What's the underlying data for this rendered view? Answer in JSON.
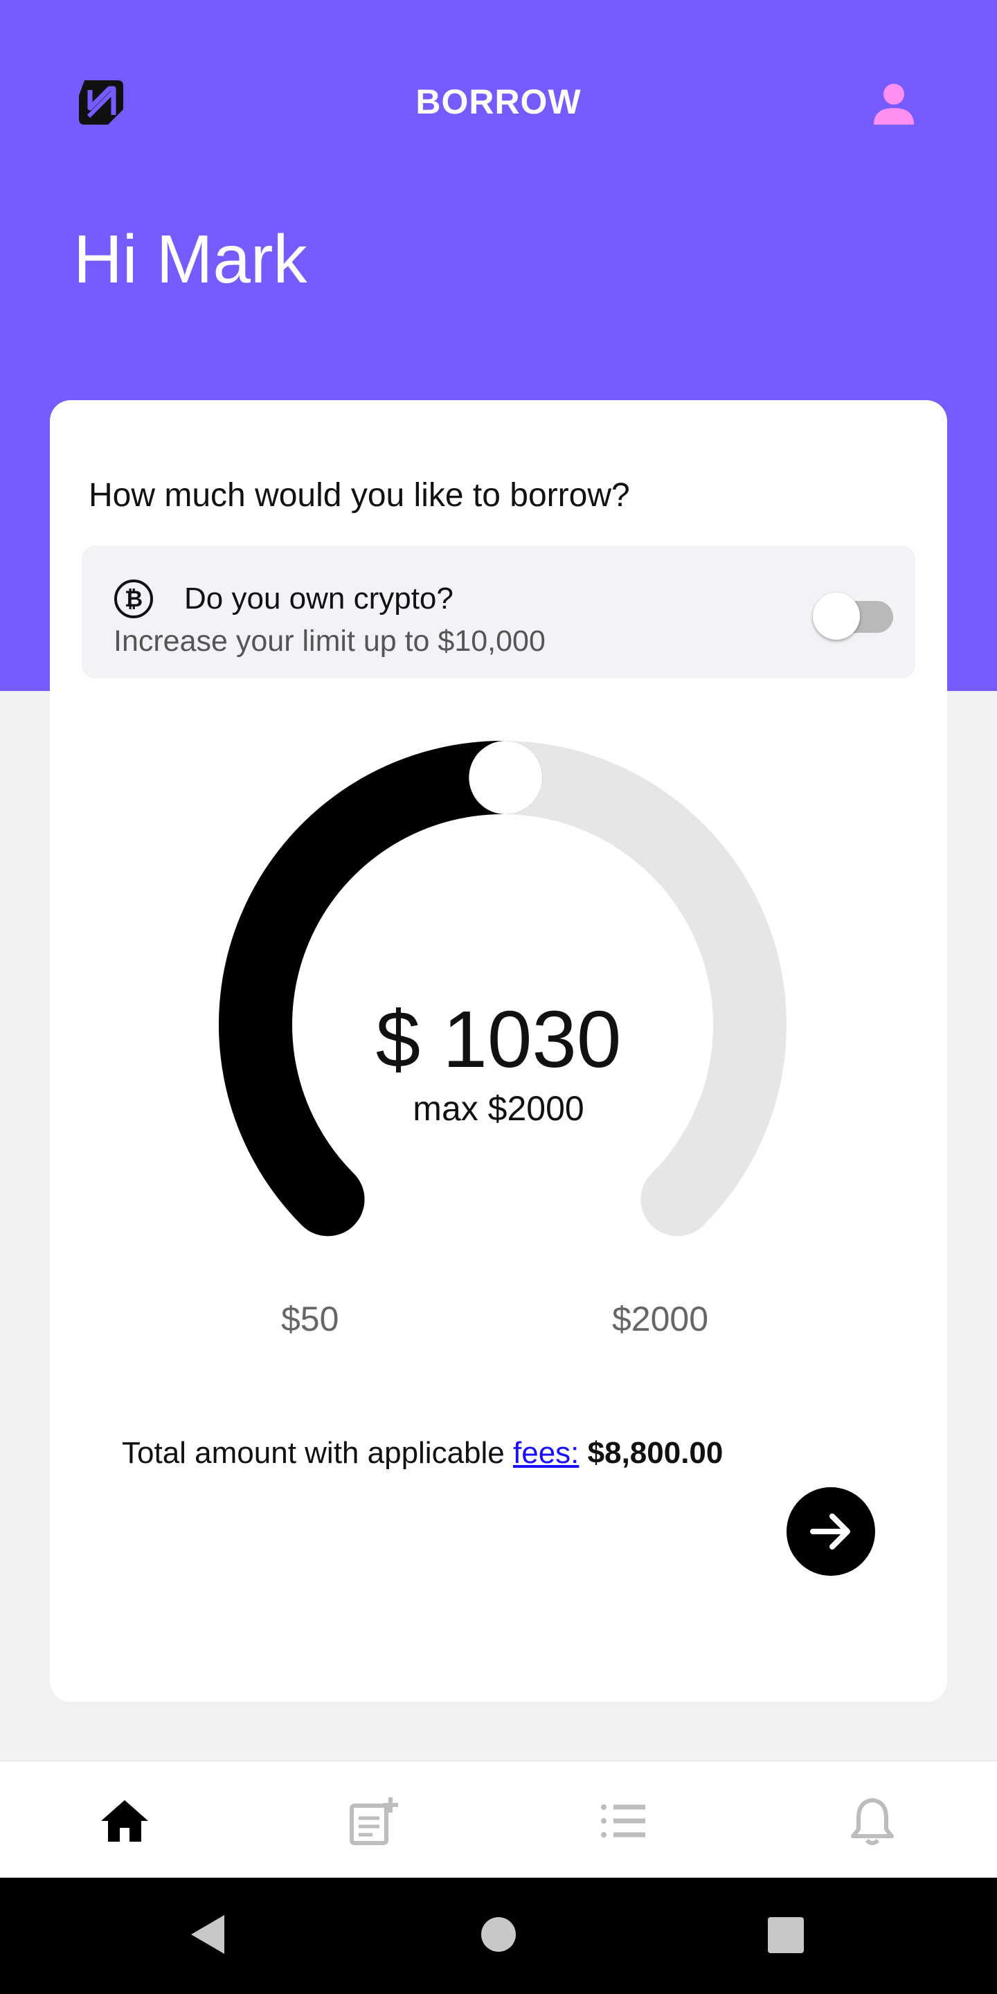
{
  "colors": {
    "accent": "#765bff",
    "profile": "#ff8ff0",
    "gauge_fill": "#000000",
    "gauge_track": "#e6e6e6",
    "link": "#1a0dff"
  },
  "header": {
    "title": "BORROW",
    "logo_icon": "brand-logo-icon",
    "profile_icon": "user-icon"
  },
  "greeting": "Hi Mark",
  "card": {
    "question": "How much would you like to borrow?",
    "crypto": {
      "icon": "bitcoin-icon",
      "title": "Do you own crypto?",
      "subtitle": "Increase your limit up to $10,000",
      "toggle_on": false
    },
    "gauge": {
      "min": 50,
      "max": 2000,
      "value": 1030,
      "amount_label": "$ 1030",
      "max_label": "max $2000",
      "min_tick": "$50",
      "max_tick": "$2000"
    },
    "total": {
      "prefix": "Total amount with applicable ",
      "link": "fees:",
      "amount": "$8,800.00"
    },
    "next_icon": "arrow-right-icon"
  },
  "bottom_nav": [
    {
      "icon": "home-icon",
      "active": true
    },
    {
      "icon": "note-add-icon",
      "active": false
    },
    {
      "icon": "list-icon",
      "active": false
    },
    {
      "icon": "bell-icon",
      "active": false
    }
  ],
  "system_nav": [
    "back-icon",
    "home-circle-icon",
    "recents-icon"
  ]
}
